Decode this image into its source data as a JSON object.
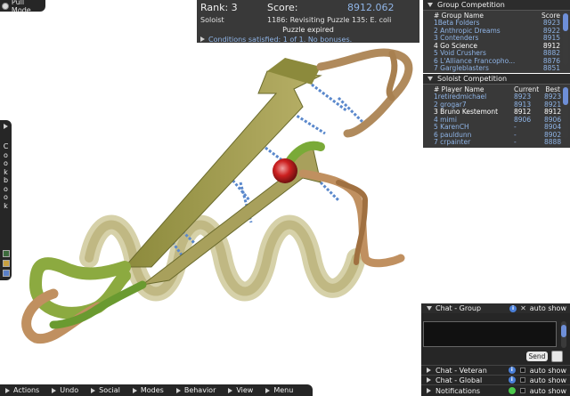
{
  "pull_mode": {
    "label": "Pull Mode"
  },
  "score_panel": {
    "rank_label": "Rank: 3",
    "score_label": "Score:",
    "score_value": "8912.062",
    "mode": "Soloist",
    "puzzle": "1186: Revisiting Puzzle 135: E. coli",
    "status": "Puzzle expired",
    "conditions": "Conditions satisfied: 1 of 1. No bonuses."
  },
  "group_competition": {
    "title": "Group Competition",
    "col_name": "# Group Name",
    "col_score": "Score",
    "rows": [
      {
        "name": "1Beta Folders",
        "score": "8923",
        "highlight": false
      },
      {
        "name": "2 Anthropic Dreams",
        "score": "8922",
        "highlight": false
      },
      {
        "name": "3 Contenders",
        "score": "8915",
        "highlight": false
      },
      {
        "name": "4 Go Science",
        "score": "8912",
        "highlight": true
      },
      {
        "name": "5 Void Crushers",
        "score": "8882",
        "highlight": false
      },
      {
        "name": "6 L'Alliance Francopho...",
        "score": "8876",
        "highlight": false
      },
      {
        "name": "7 Gargleblasters",
        "score": "8851",
        "highlight": false
      }
    ]
  },
  "soloist_competition": {
    "title": "Soloist Competition",
    "col_name": "# Player Name",
    "col_current": "Current",
    "col_best": "Best",
    "rows": [
      {
        "name": "1retiredmichael",
        "current": "8923",
        "best": "8923",
        "highlight": false
      },
      {
        "name": "2 grogar7",
        "current": "8913",
        "best": "8921",
        "highlight": false
      },
      {
        "name": "3 Bruno Kestemont",
        "current": "8912",
        "best": "8912",
        "highlight": true
      },
      {
        "name": "4 mimi",
        "current": "8906",
        "best": "8906",
        "highlight": false
      },
      {
        "name": "5 KarenCH",
        "current": "-",
        "best": "8904",
        "highlight": false
      },
      {
        "name": "6 pauldunn",
        "current": "-",
        "best": "8902",
        "highlight": false
      },
      {
        "name": "7 crpainter",
        "current": "-",
        "best": "8888",
        "highlight": false
      }
    ]
  },
  "cookbook": {
    "letters": [
      "C",
      "o",
      "o",
      "k",
      "b",
      "o",
      "o",
      "k"
    ]
  },
  "chat_group": {
    "title": "Chat - Group",
    "auto_show": "auto show",
    "send": "Send"
  },
  "chat_veteran": {
    "title": "Chat - Veteran",
    "auto_show": "auto show"
  },
  "chat_global": {
    "title": "Chat - Global",
    "auto_show": "auto show"
  },
  "notifications": {
    "title": "Notifications",
    "auto_show": "auto show"
  },
  "bottom_menu": [
    "Actions",
    "Undo",
    "Social",
    "Modes",
    "Behavior",
    "View",
    "Menu"
  ],
  "colors": {
    "link_blue": "#8fb4e6",
    "score_blue": "#8fb4e6",
    "notification_green": "#4cc84c"
  }
}
